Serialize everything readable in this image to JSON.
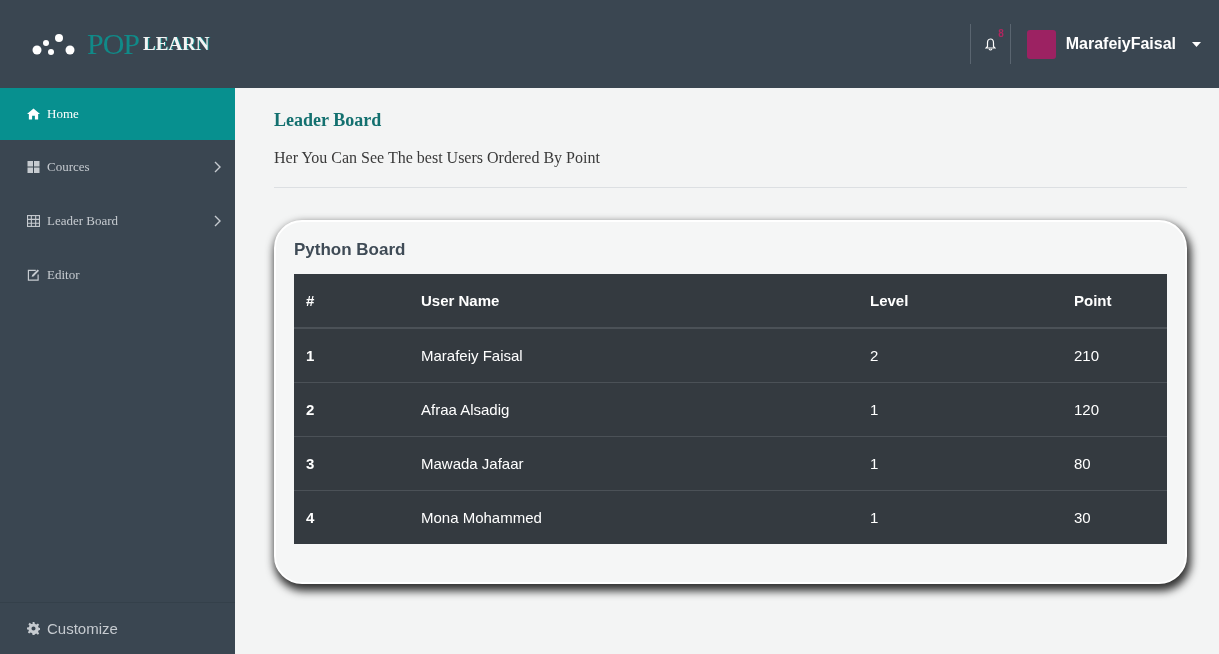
{
  "logo": {
    "first": "POP",
    "second": "LEARN"
  },
  "topbar": {
    "notifications": "8",
    "user": "MarafeiyFaisal"
  },
  "sidebar": {
    "items": [
      {
        "label": "Home",
        "kind": "home",
        "selected": true,
        "has_children": false
      },
      {
        "label": "Cources",
        "kind": "grid",
        "selected": false,
        "has_children": true
      },
      {
        "label": "Leader Board",
        "kind": "table",
        "selected": false,
        "has_children": true
      },
      {
        "label": "Editor",
        "kind": "edit",
        "selected": false,
        "has_children": false
      }
    ],
    "footer": {
      "label": "Customize"
    }
  },
  "page": {
    "title": "Leader Board",
    "subtitle": "Her You Can See The best Users Ordered By Point"
  },
  "card": {
    "title": "Python Board",
    "table": {
      "columns": [
        "#",
        "User Name",
        "Level",
        "Point"
      ],
      "rows": [
        [
          "1",
          "Marafeiy Faisal",
          "2",
          "210"
        ],
        [
          "2",
          "Afraa Alsadig",
          "1",
          "120"
        ],
        [
          "3",
          "Mawada Jafaar",
          "1",
          "80"
        ],
        [
          "4",
          "Mona Mohammed",
          "1",
          "30"
        ]
      ]
    }
  }
}
